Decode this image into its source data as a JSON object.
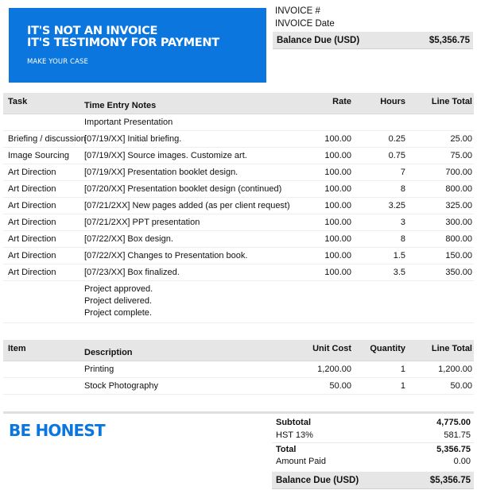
{
  "banner": {
    "line1": "IT'S NOT AN INVOICE",
    "line2": "IT'S TESTIMONY FOR PAYMENT",
    "tagline": "MAKE YOUR CASE",
    "color": "#0a76de"
  },
  "meta": {
    "invoice_number_label": "INVOICE #",
    "invoice_date_label": "INVOICE Date",
    "balance_label": "Balance Due (USD)",
    "balance_value": "$5,356.75"
  },
  "time_table": {
    "headers": [
      "Task",
      "Time Entry Notes",
      "Rate",
      "Hours",
      "Line Total"
    ],
    "intro_note": "Important Presentation",
    "rows": [
      {
        "task": "Briefing / discussion",
        "notes": "[07/19/XX] Initial briefing.",
        "rate": "100.00",
        "hours": "0.25",
        "total": "25.00"
      },
      {
        "task": "Image Sourcing",
        "notes": "[07/19/XX] Source images. Customize art.",
        "rate": "100.00",
        "hours": "0.75",
        "total": "75.00"
      },
      {
        "task": "Art Direction",
        "notes": "[07/19/XX] Presentation booklet design.",
        "rate": "100.00",
        "hours": "7",
        "total": "700.00"
      },
      {
        "task": "Art Direction",
        "notes": "[07/20/XX] Presentation booklet design (continued)",
        "rate": "100.00",
        "hours": "8",
        "total": "800.00"
      },
      {
        "task": "Art Direction",
        "notes": "[07/21/2XX] New pages added (as per client request)",
        "rate": "100.00",
        "hours": "3.25",
        "total": "325.00"
      },
      {
        "task": "Art Direction",
        "notes": "[07/21/2XX] PPT presentation",
        "rate": "100.00",
        "hours": "3",
        "total": "300.00"
      },
      {
        "task": "Art Direction",
        "notes": "[07/22/XX] Box design.",
        "rate": "100.00",
        "hours": "8",
        "total": "800.00"
      },
      {
        "task": "Art Direction",
        "notes": "[07/22/XX] Changes to Presentation book.",
        "rate": "100.00",
        "hours": "1.5",
        "total": "150.00"
      },
      {
        "task": "Art Direction",
        "notes": "[07/23/XX] Box finalized.",
        "rate": "100.00",
        "hours": "3.5",
        "total": "350.00"
      }
    ],
    "closing_notes": [
      "Project approved.",
      "Project delivered.",
      "Project complete."
    ]
  },
  "item_table": {
    "headers": [
      "Item",
      "Description",
      "Unit Cost",
      "Quantity",
      "Line Total"
    ],
    "rows": [
      {
        "item": "",
        "description": "Printing",
        "unit_cost": "1,200.00",
        "quantity": "1",
        "total": "1,200.00"
      },
      {
        "item": "",
        "description": "Stock Photography",
        "unit_cost": "50.00",
        "quantity": "1",
        "total": "50.00"
      }
    ]
  },
  "footer": {
    "slogan": "BE HONEST",
    "subtotal_label": "Subtotal",
    "subtotal_value": "4,775.00",
    "tax_label": "HST 13%",
    "tax_value": "581.75",
    "total_label": "Total",
    "total_value": "5,356.75",
    "paid_label": "Amount Paid",
    "paid_value": "0.00",
    "balance_label": "Balance Due (USD)",
    "balance_value": "$5,356.75"
  }
}
